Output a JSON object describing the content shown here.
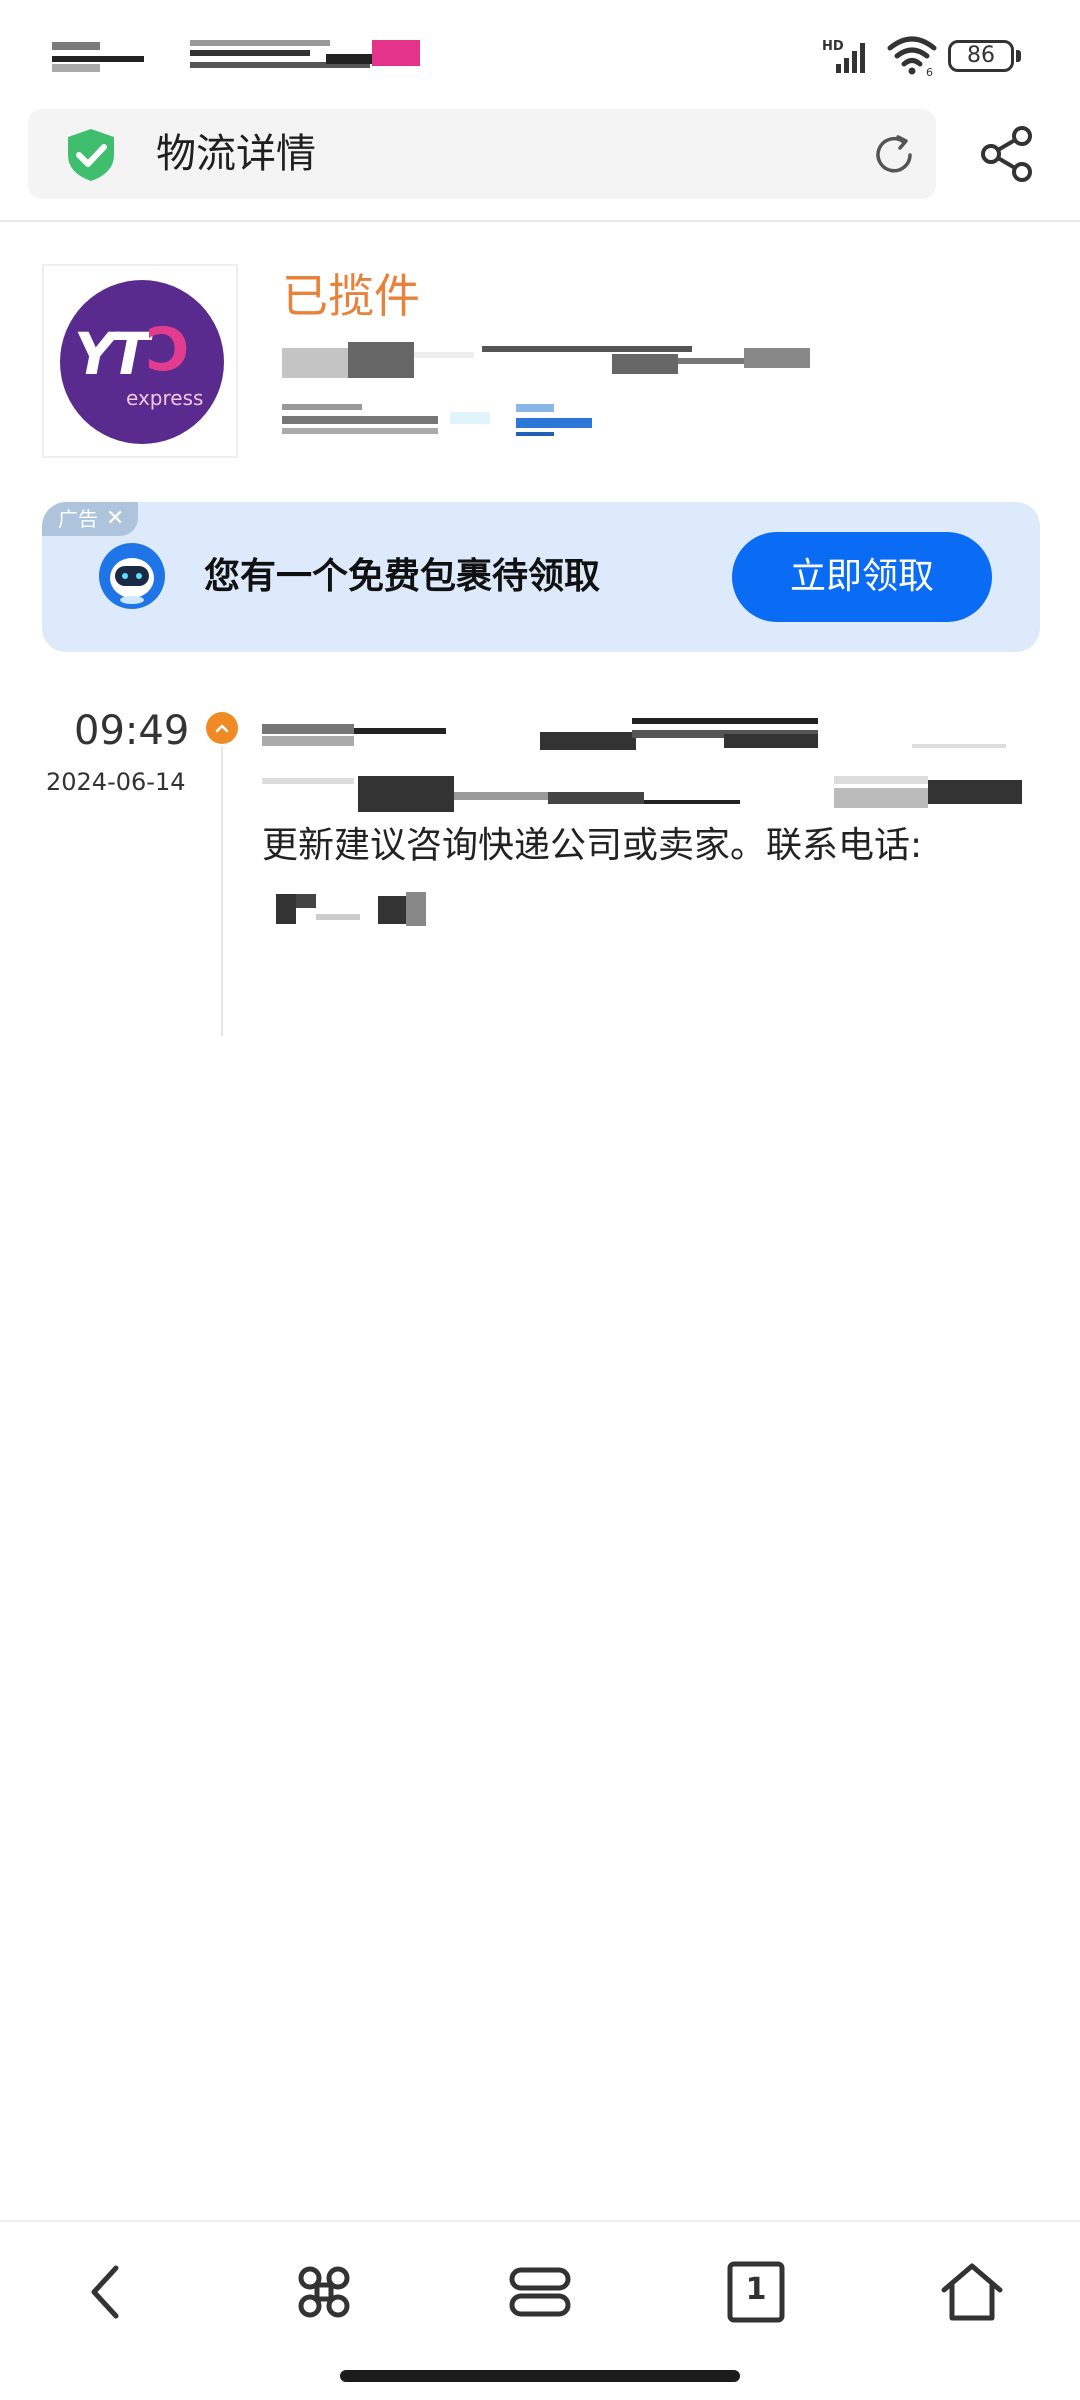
{
  "status_bar": {
    "network": "HD",
    "signal_icon": "signal-icon",
    "wifi_icon": "wifi-icon",
    "battery_level": "86"
  },
  "address_bar": {
    "title": "物流详情",
    "secure_icon": "shield-check-icon",
    "reload_icon": "reload-icon",
    "share_icon": "share-icon"
  },
  "carrier": {
    "logo_text": "YTO",
    "logo_subtext": "express",
    "status": "已揽件",
    "brand_color": "#5a2b8e",
    "status_color": "#e8823a"
  },
  "ad": {
    "tag": "广告",
    "close_icon": "close-icon",
    "text": "您有一个免费包裹待领取",
    "button": "立即领取",
    "accent": "#0a6cf5"
  },
  "timeline": {
    "time": "09:49",
    "date": "2024-06-14",
    "description": "更新建议咨询快递公司或卖家。联系电话:"
  },
  "bottom_nav": {
    "items": [
      "back-icon",
      "shortcuts-icon",
      "menu-icon",
      "tabs-icon",
      "home-icon"
    ],
    "tab_count": "1"
  }
}
